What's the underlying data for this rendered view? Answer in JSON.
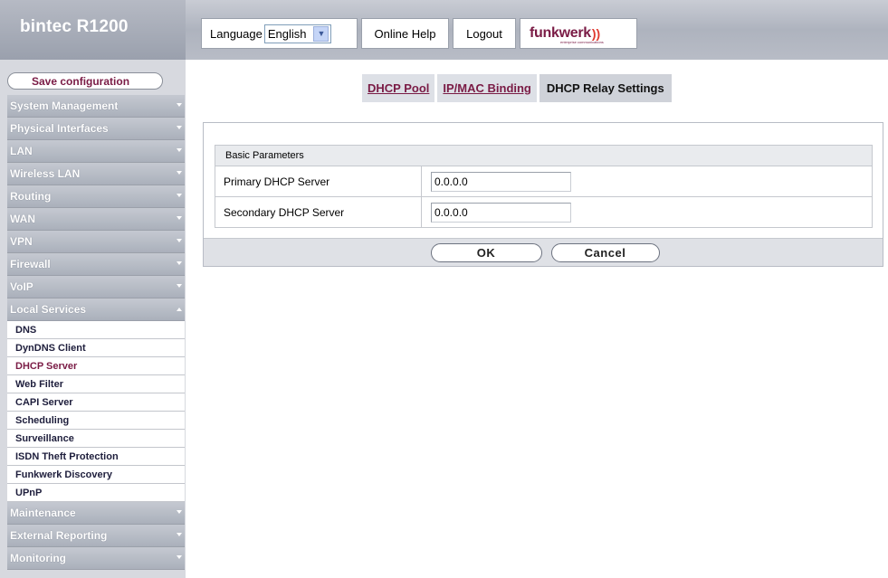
{
  "header": {
    "product_title": "bintec R1200",
    "language_label": "Language",
    "language_selected": "English",
    "online_help": "Online Help",
    "logout": "Logout",
    "brand_name": "funkwerk",
    "brand_tagline": "enterprise communications"
  },
  "sidebar": {
    "save_configuration": "Save configuration",
    "menu": [
      {
        "label": "System Management"
      },
      {
        "label": "Physical Interfaces"
      },
      {
        "label": "LAN"
      },
      {
        "label": "Wireless LAN"
      },
      {
        "label": "Routing"
      },
      {
        "label": "WAN"
      },
      {
        "label": "VPN"
      },
      {
        "label": "Firewall"
      },
      {
        "label": "VoIP"
      },
      {
        "label": "Local Services"
      },
      {
        "label": "Maintenance"
      },
      {
        "label": "External Reporting"
      },
      {
        "label": "Monitoring"
      }
    ],
    "local_services_items": [
      {
        "label": "DNS"
      },
      {
        "label": "DynDNS Client"
      },
      {
        "label": "DHCP Server"
      },
      {
        "label": "Web Filter"
      },
      {
        "label": "CAPI Server"
      },
      {
        "label": "Scheduling"
      },
      {
        "label": "Surveillance"
      },
      {
        "label": "ISDN Theft Protection"
      },
      {
        "label": "Funkwerk Discovery"
      },
      {
        "label": "UPnP"
      }
    ],
    "active_item": "DHCP Server"
  },
  "tabs": [
    {
      "label": "DHCP Pool"
    },
    {
      "label": "IP/MAC Binding"
    },
    {
      "label": "DHCP Relay Settings"
    }
  ],
  "active_tab": "DHCP Relay Settings",
  "form": {
    "section_title": "Basic Parameters",
    "primary_label": "Primary DHCP Server",
    "primary_value": "0.0.0.0",
    "secondary_label": "Secondary DHCP Server",
    "secondary_value": "0.0.0.0",
    "ok_label": "OK",
    "cancel_label": "Cancel"
  },
  "colors": {
    "accent": "#7a1b45",
    "menu_bg": "#aab0bb",
    "header_bg": "#aeb3be"
  }
}
